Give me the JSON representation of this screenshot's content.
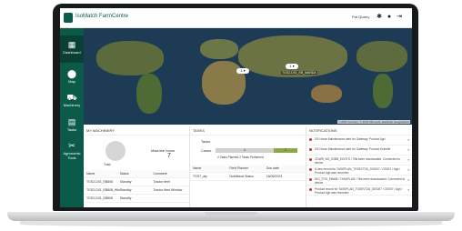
{
  "app": {
    "name": "IsoMatch FarmCentre",
    "user": "Pat Quarry",
    "brand_color": "#0c5a4a"
  },
  "topbar_icons": [
    "settings-icon",
    "help-icon",
    "logout-icon"
  ],
  "sidebar": {
    "items": [
      {
        "label": "Dashboard",
        "icon": "dashboard-icon",
        "glyph": "▦",
        "active": true
      },
      {
        "label": "Map",
        "icon": "map-pin-icon",
        "glyph": "⬤"
      },
      {
        "label": "Machinery",
        "icon": "tractor-icon",
        "glyph": "⛟"
      },
      {
        "label": "Tasks",
        "icon": "calendar-icon",
        "glyph": "▤"
      },
      {
        "label": "Agronomic Tools",
        "icon": "tools-icon",
        "glyph": "✂"
      }
    ]
  },
  "map": {
    "pins": [
      {
        "badge": "1 ▾"
      },
      {
        "badge": "1 ▾"
      }
    ],
    "pin_label": "TGS2-DIG_EB_MANDA",
    "attribution": "© 2023 TomTom, © 2023 Microsoft, Earthstar Geographics"
  },
  "panel_machinery": {
    "title": "MY MACHINERY",
    "count_label": "Machine hours",
    "count_value": "7",
    "chart_caption": "Total",
    "columns": [
      "Name",
      "Status",
      "Comment"
    ],
    "rows": [
      [
        "TGS2-DIG_EB808",
        "Standby",
        "Tractor fleet"
      ],
      [
        "TGS2-DIG_EB808_Window",
        "Standby",
        "Tractor fleet Window"
      ],
      [
        "TGS2-DIG_EB808",
        "Standby",
        ""
      ]
    ]
  },
  "panel_tasks": {
    "title": "TASKS",
    "rows_label_1": "Tasks",
    "rows_label_2": "Cases",
    "bar_values": [
      "4",
      "2"
    ],
    "bar_caption": "4 Tasks Planned  2 Tasks Performed",
    "columns": [
      "Name",
      "Field Planner",
      "Due date"
    ],
    "rows": [
      [
        "TGS7_aty",
        "Nutritional Status",
        "16/06/2023"
      ]
    ]
  },
  "panel_notifications": {
    "title": "NOTIFICATIONS",
    "items": [
      "GS Hours Maintenance alert for Gateway: Product Agri",
      "GS Hours Maintenance alert for Gateway: Product Kolnelle",
      "CDWR_BG_E2BB_EDOTS / Tills been downloaded, Connected to device",
      "A new record for TASKPLAN_TGSEVT2A_DIG007 / GS007 / Agri / Product Agri was recorded",
      "DIG_TGS_EB808 / TASKPLAN / Tills been downloaded, Connected to device",
      "Product record for TASKPLAN_TGSEVT2A_DIG007 / GS007 / Agri / Product Agri was recorded"
    ]
  }
}
